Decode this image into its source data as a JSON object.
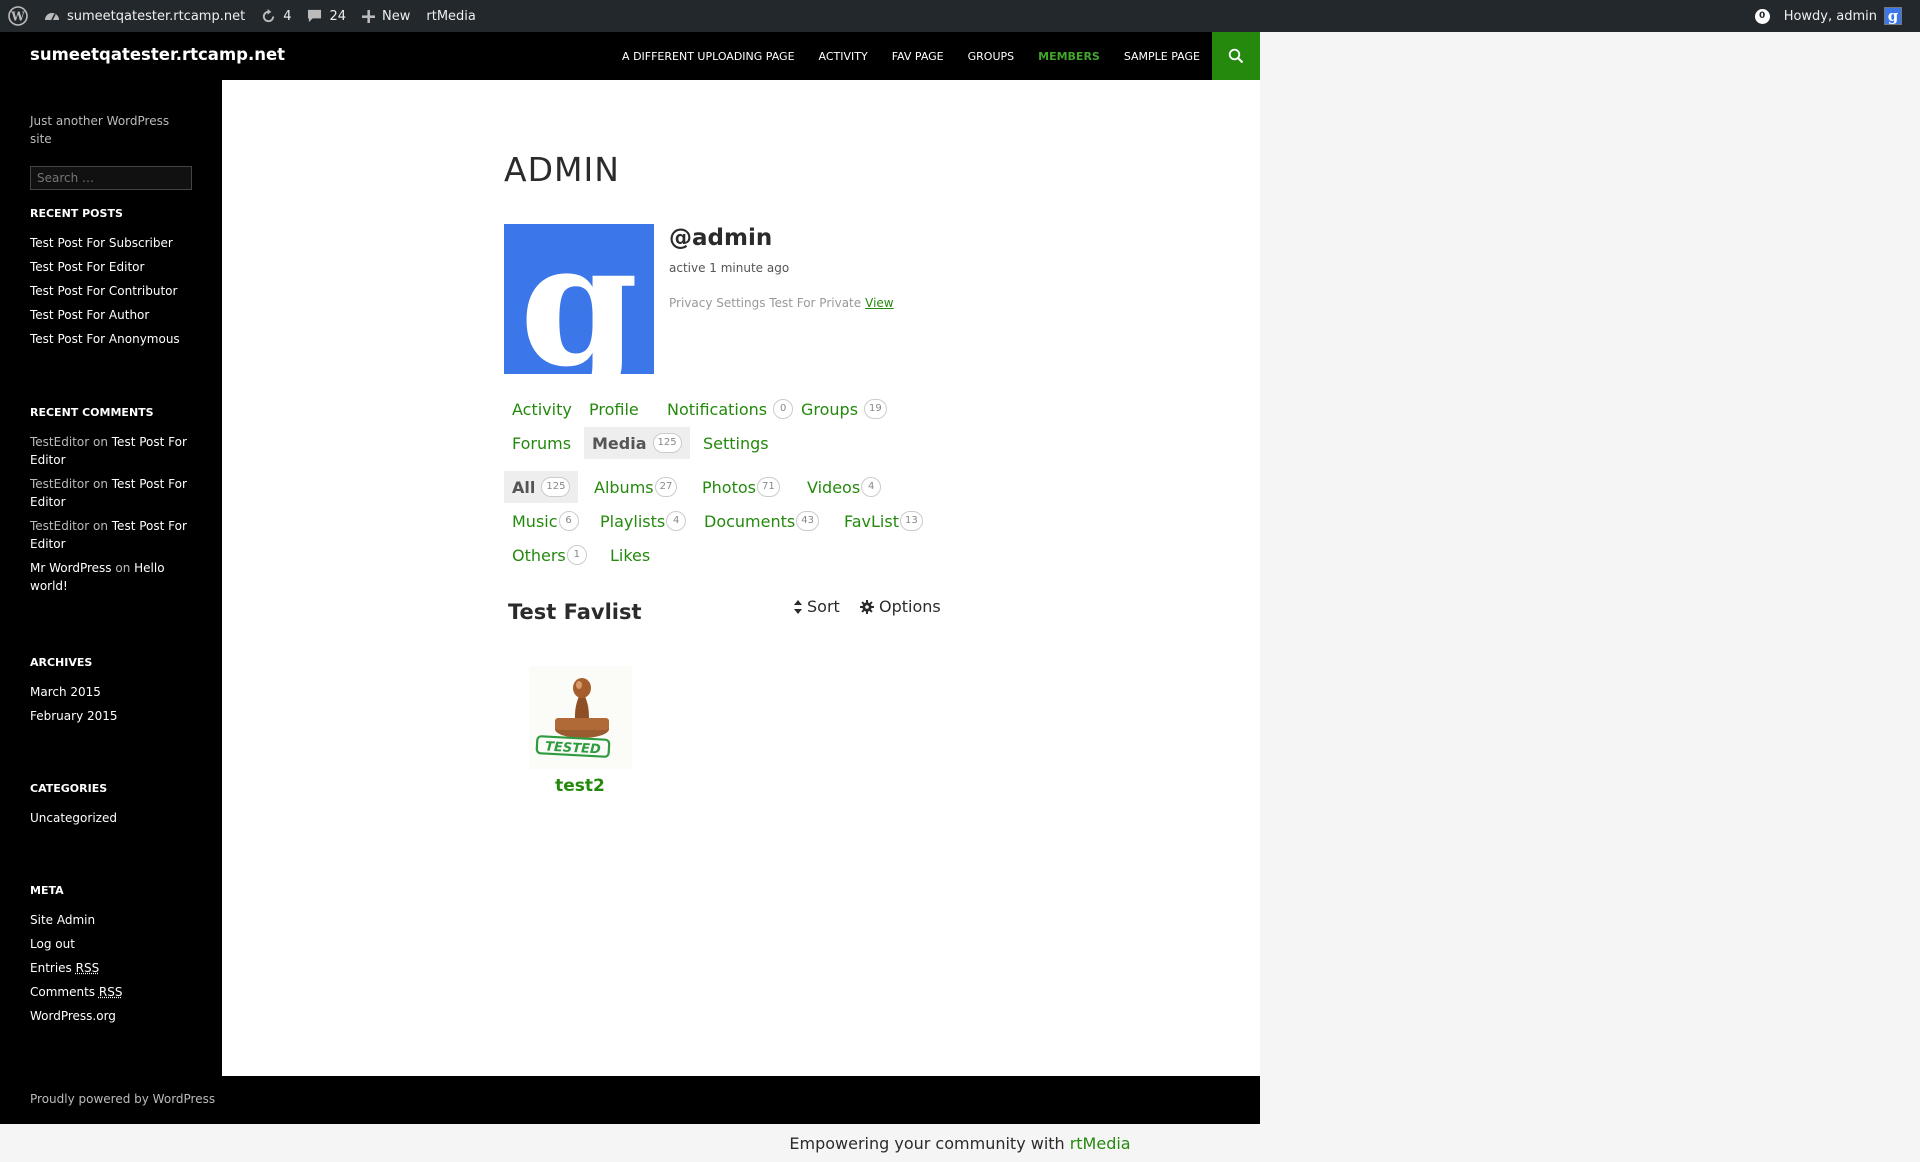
{
  "adminbar": {
    "site_name": "sumeetqatester.rtcamp.net",
    "updates_count": "4",
    "comments_count": "24",
    "new_label": "New",
    "rtmedia_label": "rtMedia",
    "notifications_count": "0",
    "howdy": "Howdy, admin"
  },
  "site": {
    "title": "sumeetqatester.rtcamp.net",
    "tagline": "Just another WordPress site",
    "search_placeholder": "Search …"
  },
  "nav": {
    "items": [
      "A DIFFERENT UPLOADING PAGE",
      "ACTIVITY",
      "FAV PAGE",
      "GROUPS",
      "MEMBERS",
      "SAMPLE PAGE"
    ],
    "active": "MEMBERS"
  },
  "sidebar": {
    "recent_posts": {
      "heading": "RECENT POSTS",
      "items": [
        "Test Post For Subscriber",
        "Test Post For Editor",
        "Test Post For Contributor",
        "Test Post For Author",
        "Test Post For Anonymous"
      ]
    },
    "recent_comments": {
      "heading": "RECENT COMMENTS",
      "items": [
        {
          "author": "TestEditor",
          "on": "on",
          "post": "Test Post For Editor"
        },
        {
          "author": "TestEditor",
          "on": "on",
          "post": "Test Post For Editor"
        },
        {
          "author": "TestEditor",
          "on": "on",
          "post": "Test Post For Editor"
        },
        {
          "author": "Mr WordPress",
          "on": "on",
          "post": "Hello world!"
        }
      ]
    },
    "archives": {
      "heading": "ARCHIVES",
      "items": [
        "March 2015",
        "February 2015"
      ]
    },
    "categories": {
      "heading": "CATEGORIES",
      "items": [
        "Uncategorized"
      ]
    },
    "meta": {
      "heading": "META",
      "site_admin": "Site Admin",
      "log_out": "Log out",
      "entries": "Entries",
      "comments": "Comments",
      "rss": "RSS",
      "wordpress_org": "WordPress.org"
    }
  },
  "profile": {
    "page_title": "ADMIN",
    "username": "@admin",
    "activity_status": "active 1 minute ago",
    "privacy_note": "Privacy Settings Test For Private",
    "view_link": "View"
  },
  "member_tabs": {
    "activity": "Activity",
    "profile": "Profile",
    "notifications": "Notifications",
    "notifications_count": "0",
    "groups": "Groups",
    "groups_count": "19",
    "forums": "Forums",
    "media": "Media",
    "media_count": "125",
    "settings": "Settings"
  },
  "media_tabs": {
    "all": "All",
    "all_count": "125",
    "albums": "Albums",
    "albums_count": "27",
    "photos": "Photos",
    "photos_count": "71",
    "videos": "Videos",
    "videos_count": "4",
    "music": "Music",
    "music_count": "6",
    "playlists": "Playlists",
    "playlists_count": "4",
    "documents": "Documents",
    "documents_count": "43",
    "favlist": "FavList",
    "favlist_count": "13",
    "others": "Others",
    "others_count": "1",
    "likes": "Likes"
  },
  "gallery": {
    "title": "Test Favlist",
    "sort_label": "Sort",
    "options_label": "Options",
    "items": [
      {
        "title": "test2",
        "stamp_text": "TESTED"
      }
    ]
  },
  "footer": {
    "powered": "Proudly powered by WordPress",
    "empowering": "Empowering your community with",
    "rtmedia": "rtMedia"
  },
  "colors": {
    "accent": "#24890d",
    "admin_bar": "#23282d",
    "avatar_blue": "#3b77e8"
  }
}
